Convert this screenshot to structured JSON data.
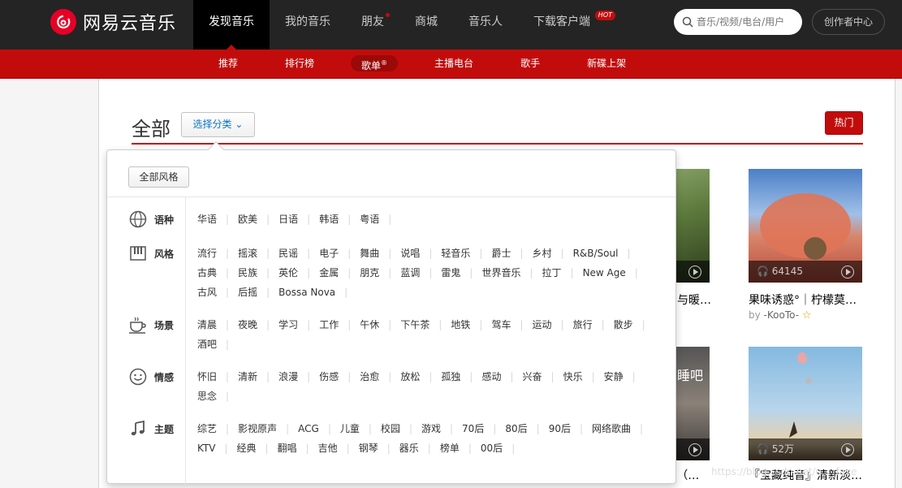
{
  "brand": {
    "name": "网易云音乐"
  },
  "nav": {
    "items": [
      {
        "label": "发现音乐"
      },
      {
        "label": "我的音乐"
      },
      {
        "label": "朋友"
      },
      {
        "label": "商城"
      },
      {
        "label": "音乐人"
      },
      {
        "label": "下载客户端"
      }
    ],
    "hot_badge": "HOT"
  },
  "search": {
    "placeholder": "音乐/视频/电台/用户"
  },
  "creator_label": "创作者中心",
  "subnav": {
    "items": [
      {
        "label": "推荐"
      },
      {
        "label": "排行榜"
      },
      {
        "label": "歌单",
        "mark": "®"
      },
      {
        "label": "主播电台"
      },
      {
        "label": "歌手"
      },
      {
        "label": "新碟上架"
      }
    ]
  },
  "page": {
    "title": "全部",
    "category_button": "选择分类",
    "hot_button": "热门"
  },
  "popup": {
    "all_style": "全部风格",
    "categories": [
      {
        "label": "语种",
        "icon": "globe-icon",
        "tags": [
          "华语",
          "欧美",
          "日语",
          "韩语",
          "粤语"
        ]
      },
      {
        "label": "风格",
        "icon": "piano-icon",
        "tags": [
          "流行",
          "摇滚",
          "民谣",
          "电子",
          "舞曲",
          "说唱",
          "轻音乐",
          "爵士",
          "乡村",
          "R&B/Soul",
          "古典",
          "民族",
          "英伦",
          "金属",
          "朋克",
          "蓝调",
          "雷鬼",
          "世界音乐",
          "拉丁",
          "New Age",
          "古风",
          "后摇",
          "Bossa Nova"
        ]
      },
      {
        "label": "场景",
        "icon": "coffee-icon",
        "tags": [
          "清晨",
          "夜晚",
          "学习",
          "工作",
          "午休",
          "下午茶",
          "地铁",
          "驾车",
          "运动",
          "旅行",
          "散步",
          "酒吧"
        ]
      },
      {
        "label": "情感",
        "icon": "smile-icon",
        "tags": [
          "怀旧",
          "清新",
          "浪漫",
          "伤感",
          "治愈",
          "放松",
          "孤独",
          "感动",
          "兴奋",
          "快乐",
          "安静",
          "思念"
        ]
      },
      {
        "label": "主题",
        "icon": "music-note-icon",
        "tags": [
          "综艺",
          "影视原声",
          "ACG",
          "儿童",
          "校园",
          "游戏",
          "70后",
          "80后",
          "90后",
          "网络歌曲",
          "KTV",
          "经典",
          "翻唱",
          "吉他",
          "钢琴",
          "器乐",
          "榜单",
          "00后"
        ]
      }
    ]
  },
  "cards": [
    {
      "count": "",
      "title": "与暖…",
      "by": ""
    },
    {
      "count": "64145",
      "title": "果味诱惑°｜柠檬莫…",
      "by_prefix": "by",
      "by": "-KooTo-"
    },
    {
      "count": "",
      "title": "s（…",
      "by": ""
    },
    {
      "count": "52万",
      "title": "『宝藏纯音』清新淡…",
      "by": ""
    }
  ],
  "card_overlay_text": {
    "sleep": "睡吧"
  },
  "watermark": "https://blog.csdn.net/u..._faye"
}
